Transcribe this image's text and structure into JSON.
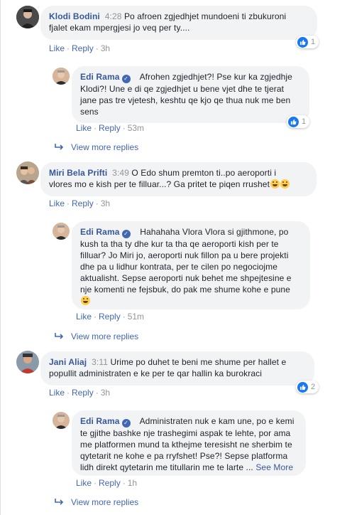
{
  "colors": {
    "link": "#4267b2",
    "author": "#365899",
    "bubble": "#f2f3f5",
    "meta": "#90949c"
  },
  "actions": {
    "like": "Like",
    "reply": "Reply",
    "dot": "·"
  },
  "view_more_label": "View more replies",
  "see_more_label": "See More",
  "comments": [
    {
      "author": "Klodi Bodini",
      "time": "4:28",
      "line1": "Po afroen zgjedhjet mundoeni ti zbukuroni",
      "line2": "fjalet ekam mpergjesi jo veq per ty....",
      "age": "3h",
      "reactions": "1",
      "reply": {
        "author": "Edi Rama",
        "line1": "Afrohen zgjedhjet?! Pse kur ka zgjedhje",
        "line2": "Klodi?! Une e di qe zgjedhjet u bene vjet dhe te tjerat",
        "line3": "jane pas tre vjetesh, keshtu qe kjo qe thua nuk me ben",
        "line4": "sens",
        "age": "53m",
        "reactions": "1"
      }
    },
    {
      "author": "Miri Bela Prifti",
      "time": "3:49",
      "line1": "O Edo shum premton ti..po aeroporti i",
      "line2": "vlores mo e kish per te filluar...? Ga pritet te piqen rrushet",
      "age": "3h",
      "reactions": "",
      "reply": {
        "author": "Edi Rama",
        "line1": "Hahahaha Vlora Vlora si gjithmone, po",
        "line2": "kush ta tha ty dhe kur ta tha qe aeroporti kish per te",
        "line3": "filluar? Jo Miri jo, aeroporti nuk fillon pa u bere projekti",
        "line4": "dhe pa u lidhur kontrata, per te cilen po negociojme",
        "line5": "aktualisht. Sepse aeroporti nuk behet me shpejtesine e",
        "line6": "nje komenti ne fejsbuk, do pak me shume kohe e pune",
        "age": "51m",
        "reactions": ""
      }
    },
    {
      "author": "Jani Aliaj",
      "time": "3:11",
      "line1": "Urime po duhet te beni me shume per hallet e",
      "line2": "popullit administraten e ke per te qar hallin ka burokraci",
      "age": "3h",
      "reactions": "2",
      "reply": {
        "author": "Edi Rama",
        "line1": "Administraten nuk e kam une, po e kemi",
        "line2": "te gjithe bashke nje trashegimi aspak te lehte, por ama",
        "line3": "me platformen mund ta kthejme teresisht ne sherbim te",
        "line4": "qytetarit ne kohe e pa rryfshet! Pse?! Sepse platforma",
        "line5": "lidh direkt qytetarin me titullarin me te larte ...",
        "age": "1h",
        "reactions": ""
      }
    }
  ]
}
